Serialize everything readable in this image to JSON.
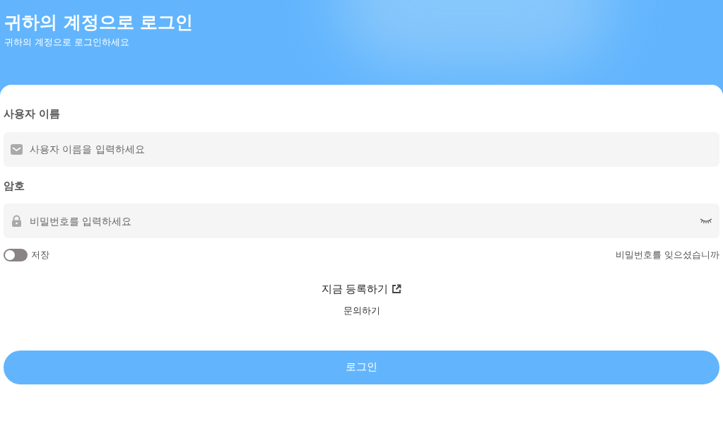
{
  "header": {
    "title": "귀하의 계정으로 로그인",
    "subtitle": "귀하의 계정으로 로그인하세요"
  },
  "username": {
    "label": "사용자 이름",
    "placeholder": "사용자 이름을 입력하세요"
  },
  "password": {
    "label": "암호",
    "placeholder": "비밀번호를 입력하세요"
  },
  "remember": {
    "label": "저장",
    "on": false
  },
  "forgot_link": "비밀번호를 잊으셨습니까",
  "register_link": "지금 등록하기",
  "contact_link": "문의하기",
  "login_button": "로그인"
}
